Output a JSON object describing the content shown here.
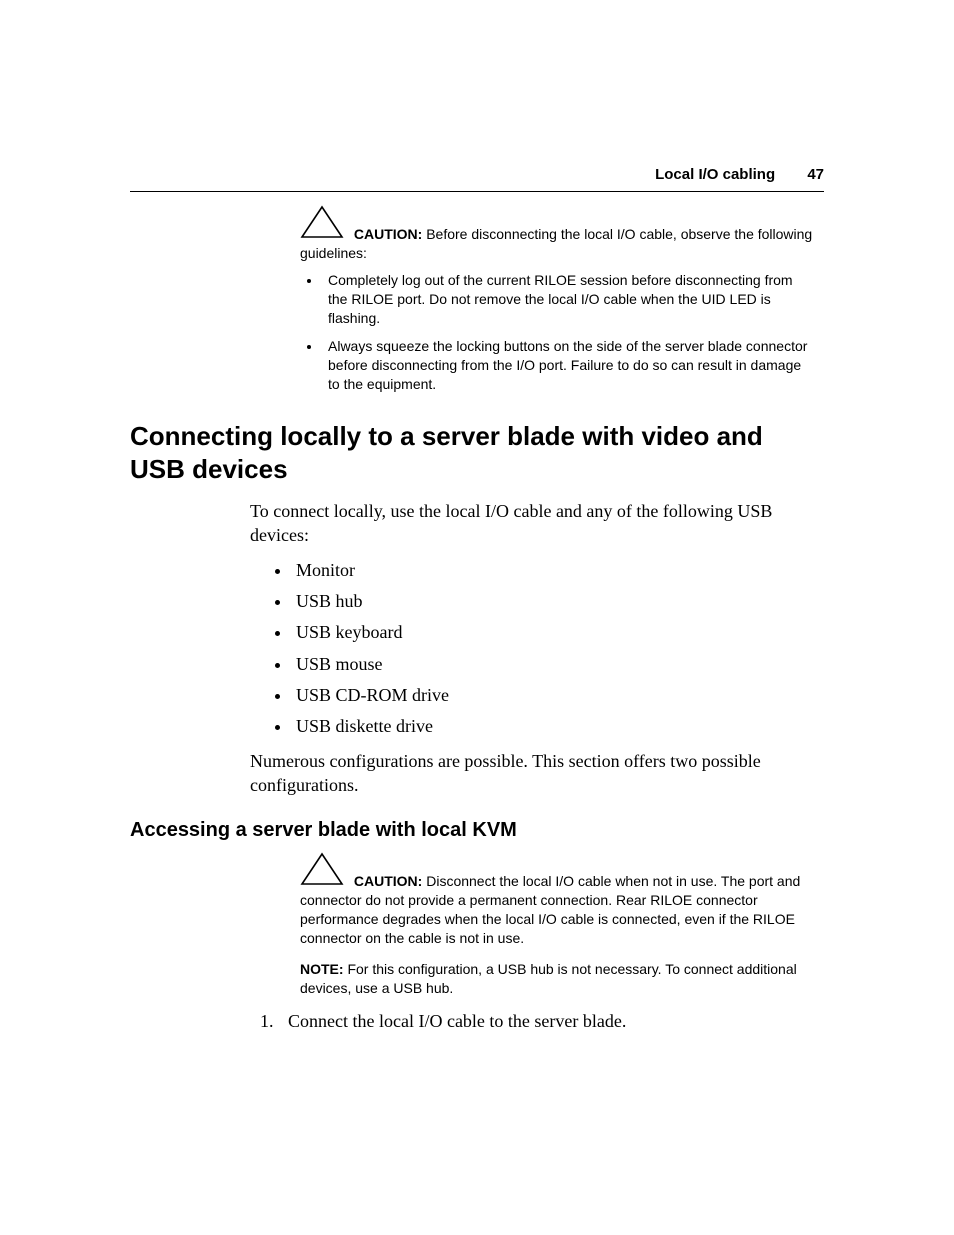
{
  "header": {
    "title": "Local I/O cabling",
    "page_number": "47"
  },
  "caution1": {
    "label": "CAUTION:",
    "text": "  Before disconnecting the local I/O cable, observe the following guidelines:",
    "items": [
      "Completely log out of the current RILOE session before disconnecting from the RILOE port. Do not remove the local I/O cable when the UID LED is flashing.",
      "Always squeeze the locking buttons on the side of the server blade connector before disconnecting from the I/O port. Failure to do so can result in damage to the equipment."
    ]
  },
  "h1": "Connecting locally to a server blade with video and USB devices",
  "intro": "To connect locally, use the local I/O cable and any of the following USB devices:",
  "device_list": [
    "Monitor",
    "USB hub",
    "USB keyboard",
    "USB mouse",
    "USB CD-ROM drive",
    "USB diskette drive"
  ],
  "intro2": "Numerous configurations are possible. This section offers two possible configurations.",
  "h2": "Accessing a server blade with local KVM",
  "caution2": {
    "label": "CAUTION:",
    "text": "  Disconnect the local I/O cable when not in use. The port and connector do not provide a permanent connection. Rear RILOE connector performance degrades when the local I/O cable is connected, even if the RILOE connector on the cable is not in use."
  },
  "note": {
    "label": "NOTE:",
    "text": "  For this configuration, a USB hub is not necessary. To connect additional devices, use a USB hub."
  },
  "steps": [
    "Connect the local I/O cable to the server blade."
  ]
}
